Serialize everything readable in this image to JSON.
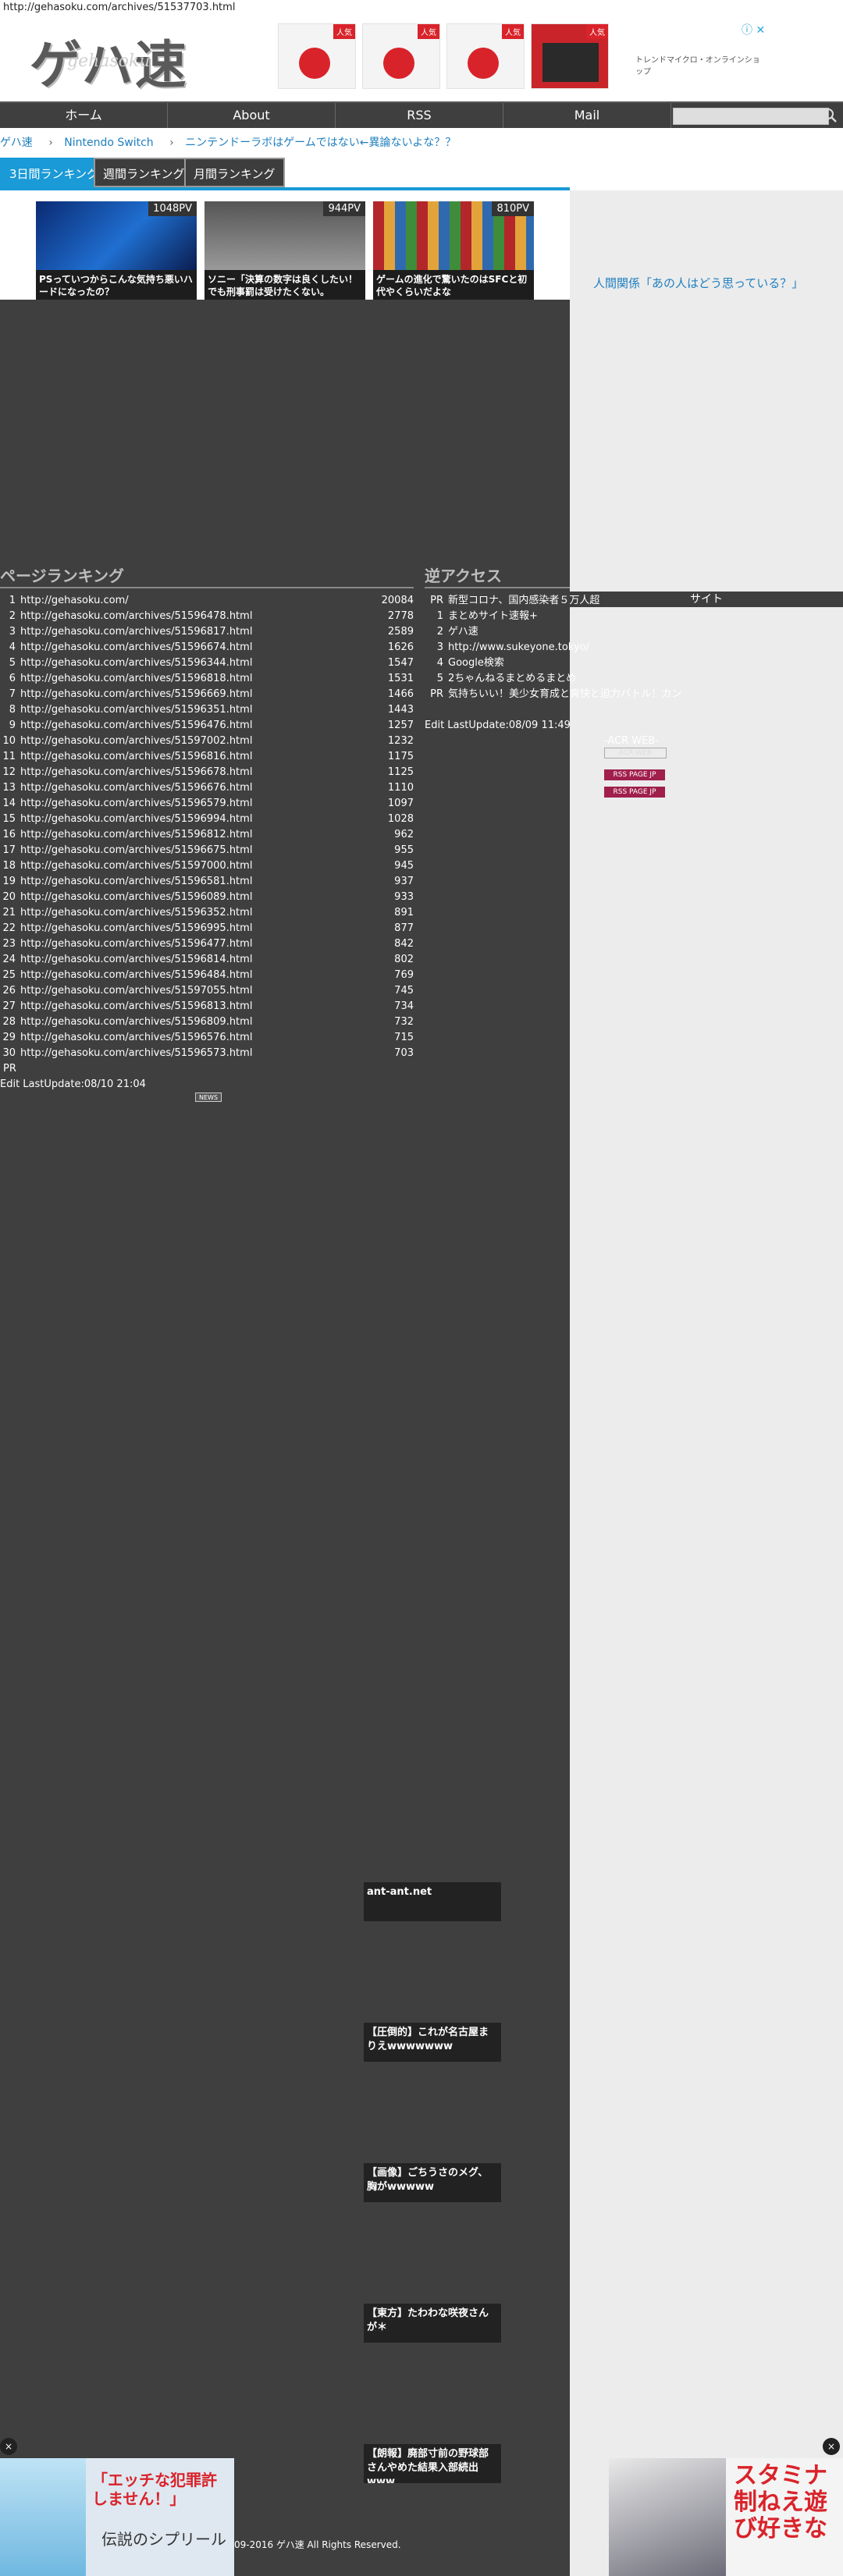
{
  "browser": {
    "url": "http://gehasoku.com/archives/51537703.html"
  },
  "header": {
    "logo_main": "ゲハ速",
    "logo_sub": "gehasoku",
    "ad": {
      "badge": "人気",
      "shop_text": "トレンドマイクロ・オンラインショップ",
      "close": "ⓘ ✕"
    }
  },
  "nav": {
    "items": [
      "ホーム",
      "About",
      "RSS",
      "Mail"
    ],
    "search_placeholder": ""
  },
  "breadcrumb": [
    "ゲハ速",
    "Nintendo Switch",
    "ニンテンドーラボはゲームではない←異論ないよな？？"
  ],
  "ranking": {
    "tabs": [
      "3日間ランキング",
      "週間ランキング",
      "月間ランキング"
    ],
    "cards": [
      {
        "pv": "1048PV",
        "title": "PSっていつからこんな気持ち悪いハードになったの？"
      },
      {
        "pv": "944PV",
        "title": "ソニー「決算の数字は良くしたい！でも刑事罰は受けたくない。"
      },
      {
        "pv": "810PV",
        "title": "ゲームの進化で驚いたのはSFCと初代やくらいだよな"
      }
    ]
  },
  "sidebar": {
    "link": "人間関係「あの人はどう思っている？」"
  },
  "page_ranking": {
    "heading": "ページランキング",
    "rows": [
      {
        "n": "1",
        "url": "http://gehasoku.com/",
        "count": "20084"
      },
      {
        "n": "2",
        "url": "http://gehasoku.com/archives/51596478.html",
        "count": "2778"
      },
      {
        "n": "3",
        "url": "http://gehasoku.com/archives/51596817.html",
        "count": "2589"
      },
      {
        "n": "4",
        "url": "http://gehasoku.com/archives/51596674.html",
        "count": "1626"
      },
      {
        "n": "5",
        "url": "http://gehasoku.com/archives/51596344.html",
        "count": "1547"
      },
      {
        "n": "6",
        "url": "http://gehasoku.com/archives/51596818.html",
        "count": "1531"
      },
      {
        "n": "7",
        "url": "http://gehasoku.com/archives/51596669.html",
        "count": "1466"
      },
      {
        "n": "8",
        "url": "http://gehasoku.com/archives/51596351.html",
        "count": "1443"
      },
      {
        "n": "9",
        "url": "http://gehasoku.com/archives/51596476.html",
        "count": "1257"
      },
      {
        "n": "10",
        "url": "http://gehasoku.com/archives/51597002.html",
        "count": "1232"
      },
      {
        "n": "11",
        "url": "http://gehasoku.com/archives/51596816.html",
        "count": "1175"
      },
      {
        "n": "12",
        "url": "http://gehasoku.com/archives/51596678.html",
        "count": "1125"
      },
      {
        "n": "13",
        "url": "http://gehasoku.com/archives/51596676.html",
        "count": "1110"
      },
      {
        "n": "14",
        "url": "http://gehasoku.com/archives/51596579.html",
        "count": "1097"
      },
      {
        "n": "15",
        "url": "http://gehasoku.com/archives/51596994.html",
        "count": "1028"
      },
      {
        "n": "16",
        "url": "http://gehasoku.com/archives/51596812.html",
        "count": "962"
      },
      {
        "n": "17",
        "url": "http://gehasoku.com/archives/51596675.html",
        "count": "955"
      },
      {
        "n": "18",
        "url": "http://gehasoku.com/archives/51597000.html",
        "count": "945"
      },
      {
        "n": "19",
        "url": "http://gehasoku.com/archives/51596581.html",
        "count": "937"
      },
      {
        "n": "20",
        "url": "http://gehasoku.com/archives/51596089.html",
        "count": "933"
      },
      {
        "n": "21",
        "url": "http://gehasoku.com/archives/51596352.html",
        "count": "891"
      },
      {
        "n": "22",
        "url": "http://gehasoku.com/archives/51596995.html",
        "count": "877"
      },
      {
        "n": "23",
        "url": "http://gehasoku.com/archives/51596477.html",
        "count": "842"
      },
      {
        "n": "24",
        "url": "http://gehasoku.com/archives/51596814.html",
        "count": "802"
      },
      {
        "n": "25",
        "url": "http://gehasoku.com/archives/51596484.html",
        "count": "769"
      },
      {
        "n": "26",
        "url": "http://gehasoku.com/archives/51597055.html",
        "count": "745"
      },
      {
        "n": "27",
        "url": "http://gehasoku.com/archives/51596813.html",
        "count": "734"
      },
      {
        "n": "28",
        "url": "http://gehasoku.com/archives/51596809.html",
        "count": "732"
      },
      {
        "n": "29",
        "url": "http://gehasoku.com/archives/51596576.html",
        "count": "715"
      },
      {
        "n": "30",
        "url": "http://gehasoku.com/archives/51596573.html",
        "count": "703"
      }
    ],
    "pr": "PR",
    "edit": "Edit LastUpdate:08/10 21:04",
    "news_badge": "NEWS"
  },
  "reverse_access": {
    "heading": "逆アクセス",
    "rows": [
      {
        "n": "PR",
        "text": "新型コロナ、国内感染者５万人超"
      },
      {
        "n": "1",
        "text": "まとめサイト速報+"
      },
      {
        "n": "2",
        "text": "ゲハ速"
      },
      {
        "n": "3",
        "text": "http://www.sukeyone.tokyo/"
      },
      {
        "n": "4",
        "text": "Google検索"
      },
      {
        "n": "5",
        "text": "2ちゃんねるまとめるまとめ"
      },
      {
        "n": "PR",
        "text": "気持ちいい！美少女育成と爽快と迫力バトル！カン..."
      }
    ],
    "edit": "Edit LastUpdate:08/09 11:49"
  },
  "site_widget": {
    "heading": "サイト",
    "acr": "-ACR WEB-",
    "acr_box": "ACR WEB",
    "badge": "RSS PAGE JP"
  },
  "articles": [
    "ant-ant.net",
    "【圧倒的】これが名古屋まりえwwwwwww",
    "【画像】ごちうさのメグ、胸がwwwww",
    "【東方】たわわな咲夜さんが＊",
    "【朗報】廃部寸前の野球部さんやめた結果入部続出www"
  ],
  "footer": {
    "copyright": "09-2016 ゲハ速 All Rights Reserved."
  },
  "float_ads": {
    "close": "×",
    "left_text": "「エッチな犯罪許しません！」",
    "left_sub": "伝説のシプリール",
    "right_text": "スタミナ制ねえ遊び好きな"
  }
}
